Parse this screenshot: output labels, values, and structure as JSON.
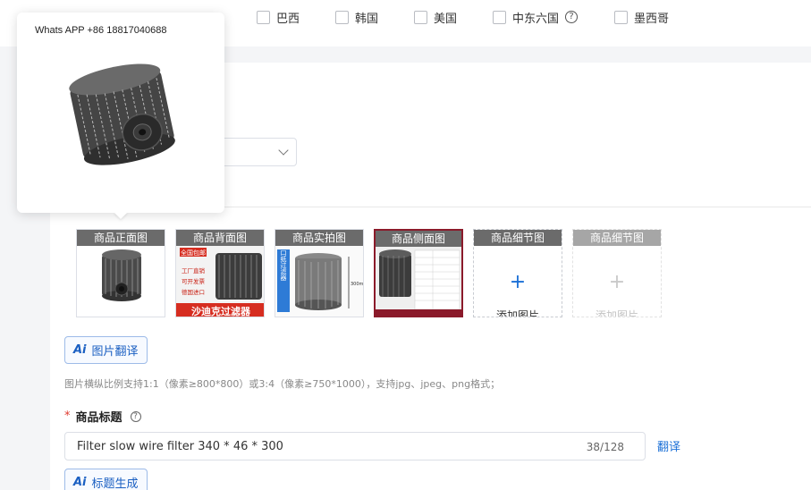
{
  "regions": [
    {
      "label": "巴西"
    },
    {
      "label": "韩国"
    },
    {
      "label": "美国"
    },
    {
      "label": "中东六国",
      "help": "?"
    },
    {
      "label": "墨西哥"
    }
  ],
  "tooltip": {
    "contact": "Whats APP +86 18817040688"
  },
  "image_slots": [
    {
      "label": "商品正面图"
    },
    {
      "label": "商品背面图"
    },
    {
      "label": "商品实拍图"
    },
    {
      "label": "商品侧面图"
    },
    {
      "label": "商品细节图",
      "add_label": "添加图片"
    },
    {
      "label": "商品细节图",
      "add_label": "添加图片"
    }
  ],
  "slot_images": {
    "back_badge": "全国包邮",
    "back_lines": [
      "工厂直销",
      "可开发票",
      "德国进口"
    ],
    "back_banner": "沙迪克过滤器",
    "real_side": "进口纸过滤器",
    "real_dim": "300mm"
  },
  "image_translate_button": "图片翻译",
  "image_hint": "图片横纵比例支持1:1（像素≥800*800）或3:4（像素≥750*1000），支持jpg、jpeg、png格式；",
  "product_title": {
    "required_mark": "*",
    "label": "商品标题",
    "value": "Filter slow wire filter 340 * 46 * 300",
    "count": "38/128",
    "translate": "翻译"
  },
  "title_generate_button": "标题生成",
  "ai_mark": "Ai",
  "colors": {
    "accent": "#1a6fd6",
    "required": "#e03a2f",
    "slot_label": "#6b6b6b"
  }
}
